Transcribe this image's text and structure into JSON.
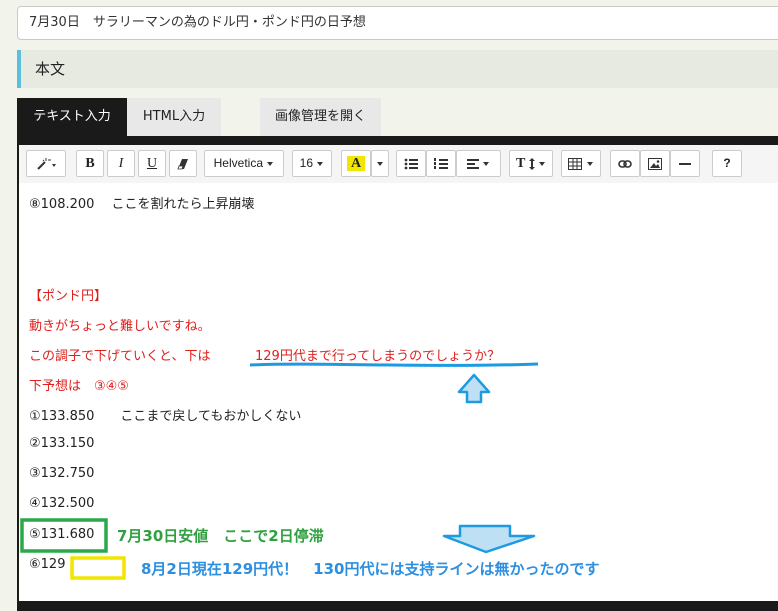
{
  "post_title": "7月30日　サラリーマンの為のドル円・ポンド円の日予想",
  "section_heading": "本文",
  "tabs": {
    "text": "テキスト入力",
    "html": "HTML入力",
    "images": "画像管理を開く"
  },
  "toolbar": {
    "bold": "B",
    "italic": "I",
    "underline": "U",
    "font_family": "Helvetica",
    "font_size": "16",
    "font_color": "A",
    "text_size": "T",
    "help": "?"
  },
  "content": {
    "lines": [
      "⑧108.200　 ここを割れたら上昇崩壊",
      "【ポンド円】",
      "動きがちょっと難しいですね。",
      "この調子で下げていくと、下は",
      "129円代まで行ってしまうのでしょうか？",
      "下予想は　③④⑤",
      "①133.850　　ここまで戻してもおかしくない",
      "②133.150",
      "③132.750",
      "④132.500",
      "⑤131.680",
      "⑥129"
    ]
  },
  "annotations": {
    "low_note": "7月30日安値　ここで2日停滞",
    "current_note": "8月2日現在129円代！　130円代には支持ラインは無かったのです"
  },
  "colors": {
    "red_text": "#e0201c",
    "blue_mark": "#1e9be0",
    "green_mark": "#2aa84a",
    "yellow_box": "#f2e600",
    "green_text": "#30a040",
    "blue_text": "#2c8fe0"
  }
}
